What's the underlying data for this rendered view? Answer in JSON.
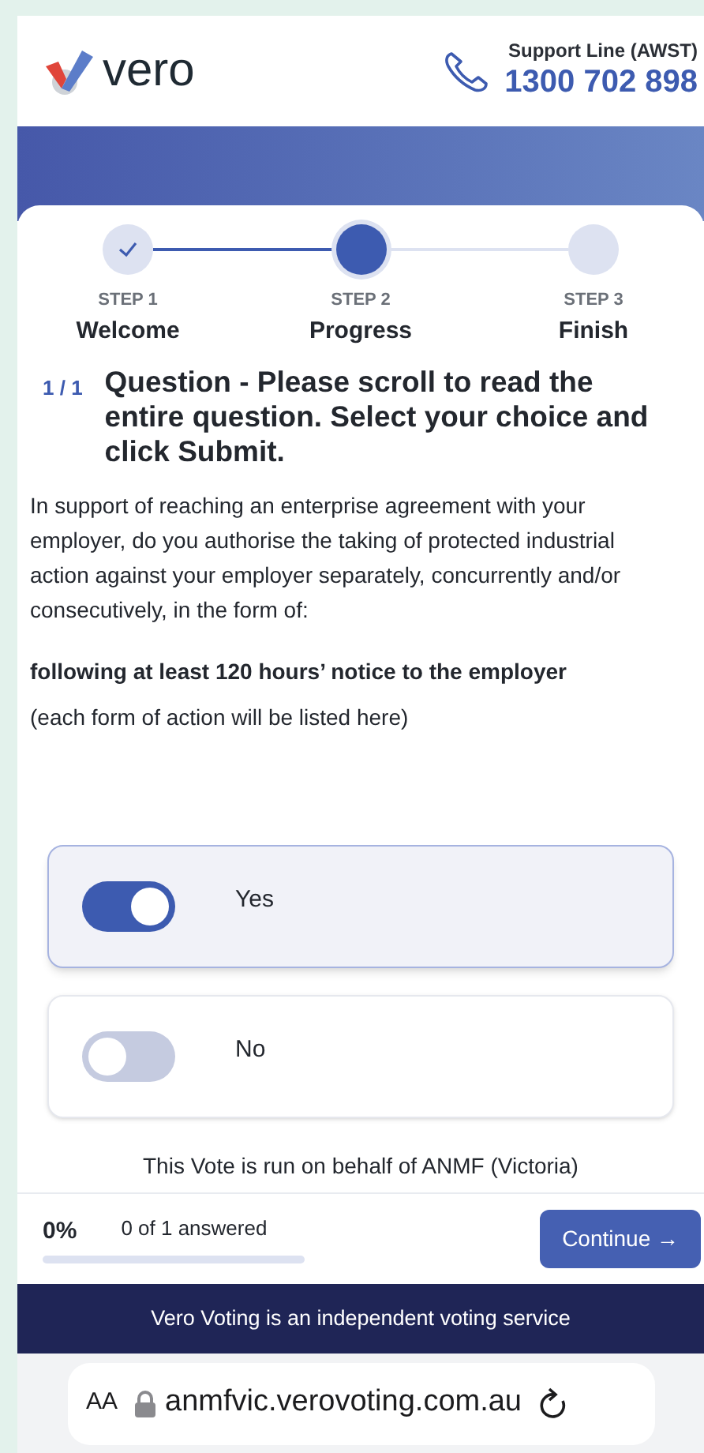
{
  "header": {
    "brand": "vero",
    "support_label": "Support Line (AWST)",
    "support_phone": "1300 702 898"
  },
  "steps": [
    {
      "label": "STEP 1",
      "title": "Welcome",
      "done": true,
      "selected": false
    },
    {
      "label": "STEP 2",
      "title": "Progress",
      "done": false,
      "selected": true
    },
    {
      "label": "STEP 3",
      "title": "Finish",
      "done": false,
      "selected": false
    }
  ],
  "question": {
    "number": "1 / 1",
    "title": "Question - Please scroll to read the entire question. Select your choice and click Submit.",
    "body": "In support of reaching an enterprise agreement with your employer, do you authorise the taking of protected industrial action against your employer separately, concurrently and/or consecutively, in the form of:",
    "emphasis": "following at least 120 hours’ notice to the employer",
    "note": "(each form of action will be listed here)"
  },
  "options": [
    {
      "label": "Yes",
      "selected": true
    },
    {
      "label": "No",
      "selected": false
    }
  ],
  "footer_note": "This Vote is run on behalf of ANMF (Victoria)",
  "progress": {
    "percent": "0%",
    "answered": "0 of 1 answered",
    "level": 0,
    "button": "Continue →"
  },
  "banner": "Vero Voting is an independent voting service",
  "browser_bar": {
    "text_size": "AA",
    "url": "anmfvic.verovoting.com.au"
  }
}
